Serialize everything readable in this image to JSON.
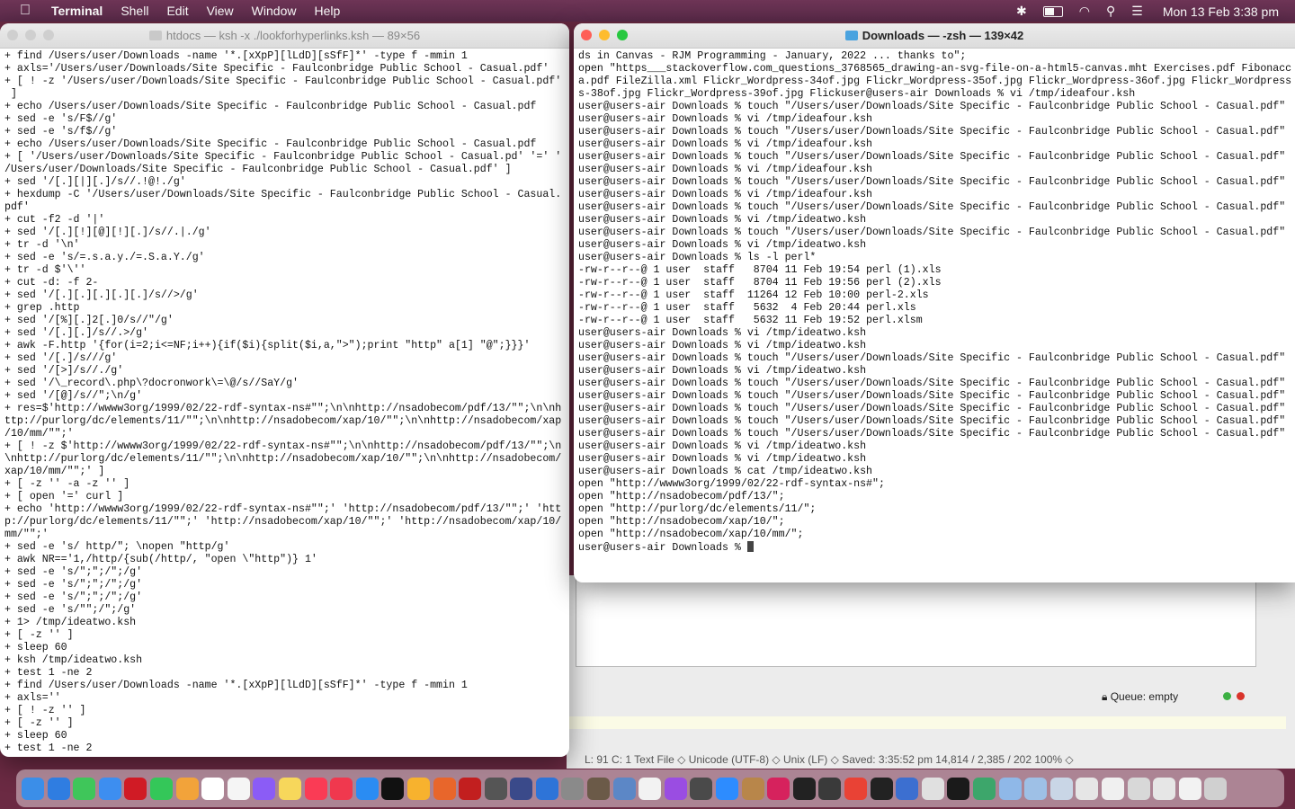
{
  "menubar": {
    "apple_icon": "apple-icon",
    "app_name": "Terminal",
    "items": [
      "Shell",
      "Edit",
      "View",
      "Window",
      "Help"
    ],
    "battery_level": 0.55,
    "clock": "Mon 13 Feb  3:38 pm"
  },
  "left_terminal": {
    "title": "htdocs — ksh -x ./lookforhyperlinks.ksh — 89×56",
    "text": "+ find /Users/user/Downloads -name '*.[xXpP][lLdD][sSfF]*' -type f -mmin 1\n+ axls='/Users/user/Downloads/Site Specific - Faulconbridge Public School - Casual.pdf'\n+ [ ! -z '/Users/user/Downloads/Site Specific - Faulconbridge Public School - Casual.pdf'\n ]\n+ echo /Users/user/Downloads/Site Specific - Faulconbridge Public School - Casual.pdf\n+ sed -e 's/F$//g'\n+ sed -e 's/f$//g'\n+ echo /Users/user/Downloads/Site Specific - Faulconbridge Public School - Casual.pdf\n+ [ '/Users/user/Downloads/Site Specific - Faulconbridge Public School - Casual.pd' '=' '\n/Users/user/Downloads/Site Specific - Faulconbridge Public School - Casual.pdf' ]\n+ sed '/[.][|][.]/s//.!@!./g'\n+ hexdump -C '/Users/user/Downloads/Site Specific - Faulconbridge Public School - Casual.\npdf'\n+ cut -f2 -d '|'\n+ sed '/[.][!][@][!][.]/s//.|./g'\n+ tr -d '\\n'\n+ sed -e 's/=.s.a.y./=.S.a.Y./g'\n+ tr -d $'\\''\n+ cut -d: -f 2-\n+ sed '/[.][.][.][.][.]/s//>/g'\n+ grep .http\n+ sed '/[%][.]2[.]0/s//\"/g'\n+ sed '/[.][.]/s//.>/g'\n+ awk -F.http '{for(i=2;i<=NF;i++){if($i){split($i,a,\">\");print \"http\" a[1] \"@\";}}}'\n+ sed '/[.]/s///g'\n+ sed '/[>]/s//./g'\n+ sed '/\\_record\\.php\\?docronwork\\=\\@/s//SaY/g'\n+ sed '/[@]/s//\";\\n/g'\n+ res=$'http://wwww3org/1999/02/22-rdf-syntax-ns#\"\";\\n\\nhttp://nsadobecom/pdf/13/\"\";\\n\\nh\nttp://purlorg/dc/elements/11/\"\";\\n\\nhttp://nsadobecom/xap/10/\"\";\\n\\nhttp://nsadobecom/xap\n/10/mm/\"\";'\n+ [ ! -z $'http://wwww3org/1999/02/22-rdf-syntax-ns#\"\";\\n\\nhttp://nsadobecom/pdf/13/\"\";\\n\n\\nhttp://purlorg/dc/elements/11/\"\";\\n\\nhttp://nsadobecom/xap/10/\"\";\\n\\nhttp://nsadobecom/\nxap/10/mm/\"\";' ]\n+ [ -z '' -a -z '' ]\n+ [ open '=' curl ]\n+ echo 'http://wwww3org/1999/02/22-rdf-syntax-ns#\"\";' 'http://nsadobecom/pdf/13/\"\";' 'htt\np://purlorg/dc/elements/11/\"\";' 'http://nsadobecom/xap/10/\"\";' 'http://nsadobecom/xap/10/\nmm/\"\";'\n+ sed -e 's/ http/\"; \\nopen \"http/g'\n+ awk NR=='1,/http/{sub(/http/, \"open \\\"http\")} 1'\n+ sed -e 's/\";\";/\";/g'\n+ sed -e 's/\";\";/\";/g'\n+ sed -e 's/\";\";/\";/g'\n+ sed -e 's/\"\";/\";/g'\n+ 1> /tmp/ideatwo.ksh\n+ [ -z '' ]\n+ sleep 60\n+ ksh /tmp/ideatwo.ksh\n+ test 1 -ne 2\n+ find /Users/user/Downloads -name '*.[xXpP][lLdD][sSfF]*' -type f -mmin 1\n+ axls=''\n+ [ ! -z '' ]\n+ [ -z '' ]\n+ sleep 60\n+ test 1 -ne 2"
  },
  "right_terminal": {
    "title": "Downloads — -zsh — 139×42",
    "text": "ds in Canvas - RJM Programming - January, 2022 ... thanks to\";\nopen \"https___stackoverflow.com_questions_3768565_drawing-an-svg-file-on-a-html5-canvas.mht Exercises.pdf Fibonacc\na.pdf FileZilla.xml Flickr_Wordpress-34of.jpg Flickr_Wordpress-35of.jpg Flickr_Wordpress-36of.jpg Flickr_Wordpress\ns-38of.jpg Flickr_Wordpress-39of.jpg Flickuser@users-air Downloads % vi /tmp/ideafour.ksh\nuser@users-air Downloads % touch \"/Users/user/Downloads/Site Specific - Faulconbridge Public School - Casual.pdf\"\nuser@users-air Downloads % vi /tmp/ideafour.ksh\nuser@users-air Downloads % touch \"/Users/user/Downloads/Site Specific - Faulconbridge Public School - Casual.pdf\"\nuser@users-air Downloads % vi /tmp/ideafour.ksh\nuser@users-air Downloads % touch \"/Users/user/Downloads/Site Specific - Faulconbridge Public School - Casual.pdf\"\nuser@users-air Downloads % vi /tmp/ideafour.ksh\nuser@users-air Downloads % touch \"/Users/user/Downloads/Site Specific - Faulconbridge Public School - Casual.pdf\"\nuser@users-air Downloads % vi /tmp/ideafour.ksh\nuser@users-air Downloads % touch \"/Users/user/Downloads/Site Specific - Faulconbridge Public School - Casual.pdf\"\nuser@users-air Downloads % vi /tmp/ideatwo.ksh\nuser@users-air Downloads % touch \"/Users/user/Downloads/Site Specific - Faulconbridge Public School - Casual.pdf\"\nuser@users-air Downloads % vi /tmp/ideatwo.ksh\nuser@users-air Downloads % ls -l perl*\n-rw-r--r--@ 1 user  staff   8704 11 Feb 19:54 perl (1).xls\n-rw-r--r--@ 1 user  staff   8704 11 Feb 19:56 perl (2).xls\n-rw-r--r--@ 1 user  staff  11264 12 Feb 10:00 perl-2.xls\n-rw-r--r--@ 1 user  staff   5632  4 Feb 20:44 perl.xls\n-rw-r--r--@ 1 user  staff   5632 11 Feb 19:52 perl.xlsm\nuser@users-air Downloads % vi /tmp/ideatwo.ksh\nuser@users-air Downloads % vi /tmp/ideatwo.ksh\nuser@users-air Downloads % touch \"/Users/user/Downloads/Site Specific - Faulconbridge Public School - Casual.pdf\"\nuser@users-air Downloads % vi /tmp/ideatwo.ksh\nuser@users-air Downloads % touch \"/Users/user/Downloads/Site Specific - Faulconbridge Public School - Casual.pdf\"\nuser@users-air Downloads % touch \"/Users/user/Downloads/Site Specific - Faulconbridge Public School - Casual.pdf\"\nuser@users-air Downloads % touch \"/Users/user/Downloads/Site Specific - Faulconbridge Public School - Casual.pdf\"\nuser@users-air Downloads % touch \"/Users/user/Downloads/Site Specific - Faulconbridge Public School - Casual.pdf\"\nuser@users-air Downloads % touch \"/Users/user/Downloads/Site Specific - Faulconbridge Public School - Casual.pdf\"\nuser@users-air Downloads % vi /tmp/ideatwo.ksh\nuser@users-air Downloads % vi /tmp/ideatwo.ksh\nuser@users-air Downloads % cat /tmp/ideatwo.ksh\nopen \"http://wwww3org/1999/02/22-rdf-syntax-ns#\";\nopen \"http://nsadobecom/pdf/13/\";\nopen \"http://purlorg/dc/elements/11/\";\nopen \"http://nsadobecom/xap/10/\";\nopen \"http://nsadobecom/xap/10/mm/\";",
    "prompt": "user@users-air Downloads % "
  },
  "background_editor": {
    "queue_label": "Queue: empty",
    "status_line": "L: 91 C: 1      Text File  ◇   Unicode (UTF-8)  ◇   Unix (LF)  ◇      Saved: 3:35:52 pm      14,814 / 2,385 / 202      100%  ◇"
  },
  "dock": {
    "apps": [
      {
        "name": "finder",
        "color": "#3b8ee8"
      },
      {
        "name": "safari",
        "color": "#2f7de1"
      },
      {
        "name": "messages",
        "color": "#3fc65a"
      },
      {
        "name": "mail",
        "color": "#3d8ef0"
      },
      {
        "name": "opera",
        "color": "#d01b25"
      },
      {
        "name": "facetime",
        "color": "#34c759"
      },
      {
        "name": "photos",
        "color": "#f2a33a"
      },
      {
        "name": "calendar",
        "color": "#ffffff"
      },
      {
        "name": "reminders",
        "color": "#f5f5f5"
      },
      {
        "name": "launchpad",
        "color": "#8b5cf6"
      },
      {
        "name": "notes",
        "color": "#f7d75b"
      },
      {
        "name": "music",
        "color": "#fa3b55"
      },
      {
        "name": "news",
        "color": "#f0384e"
      },
      {
        "name": "app-store",
        "color": "#2a8cf3"
      },
      {
        "name": "apple-tv",
        "color": "#111111"
      },
      {
        "name": "sketch",
        "color": "#f7b22e"
      },
      {
        "name": "firefox",
        "color": "#e8662b"
      },
      {
        "name": "filezilla",
        "color": "#c21f1f"
      },
      {
        "name": "calculator",
        "color": "#555555"
      },
      {
        "name": "bbedit",
        "color": "#3a4a8a"
      },
      {
        "name": "xcode",
        "color": "#2e74d8"
      },
      {
        "name": "system-preferences",
        "color": "#8a8a8a"
      },
      {
        "name": "gimp",
        "color": "#6b5a48"
      },
      {
        "name": "preview",
        "color": "#5c87c6"
      },
      {
        "name": "textedit",
        "color": "#f2f2f2"
      },
      {
        "name": "podcasts",
        "color": "#9a4de2"
      },
      {
        "name": "gimp-2",
        "color": "#4a4a4a"
      },
      {
        "name": "zoom",
        "color": "#2d8cff"
      },
      {
        "name": "contacts",
        "color": "#b8864a"
      },
      {
        "name": "intellij",
        "color": "#d6225d"
      },
      {
        "name": "terminal",
        "color": "#222222"
      },
      {
        "name": "quicktime",
        "color": "#3a3a3a"
      },
      {
        "name": "chrome",
        "color": "#e94235"
      },
      {
        "name": "inkscape",
        "color": "#222222"
      },
      {
        "name": "arc-app",
        "color": "#3c6fd0"
      },
      {
        "name": "script-editor",
        "color": "#e0e0e0"
      },
      {
        "name": "activity-monitor",
        "color": "#1a1a1a"
      },
      {
        "name": "vysor",
        "color": "#3da66b"
      },
      {
        "name": "folder-1",
        "color": "#8fb8e8"
      },
      {
        "name": "folder-2",
        "color": "#9ec0e6"
      },
      {
        "name": "folder-3",
        "color": "#c9d6e6"
      },
      {
        "name": "window-1",
        "color": "#e6e6e6"
      },
      {
        "name": "window-2",
        "color": "#f0f0f0"
      },
      {
        "name": "window-3",
        "color": "#d8d8d8"
      },
      {
        "name": "window-4",
        "color": "#e6e6e6"
      },
      {
        "name": "window-5",
        "color": "#f2f2f2"
      },
      {
        "name": "trash",
        "color": "#d0d0d0"
      }
    ]
  }
}
